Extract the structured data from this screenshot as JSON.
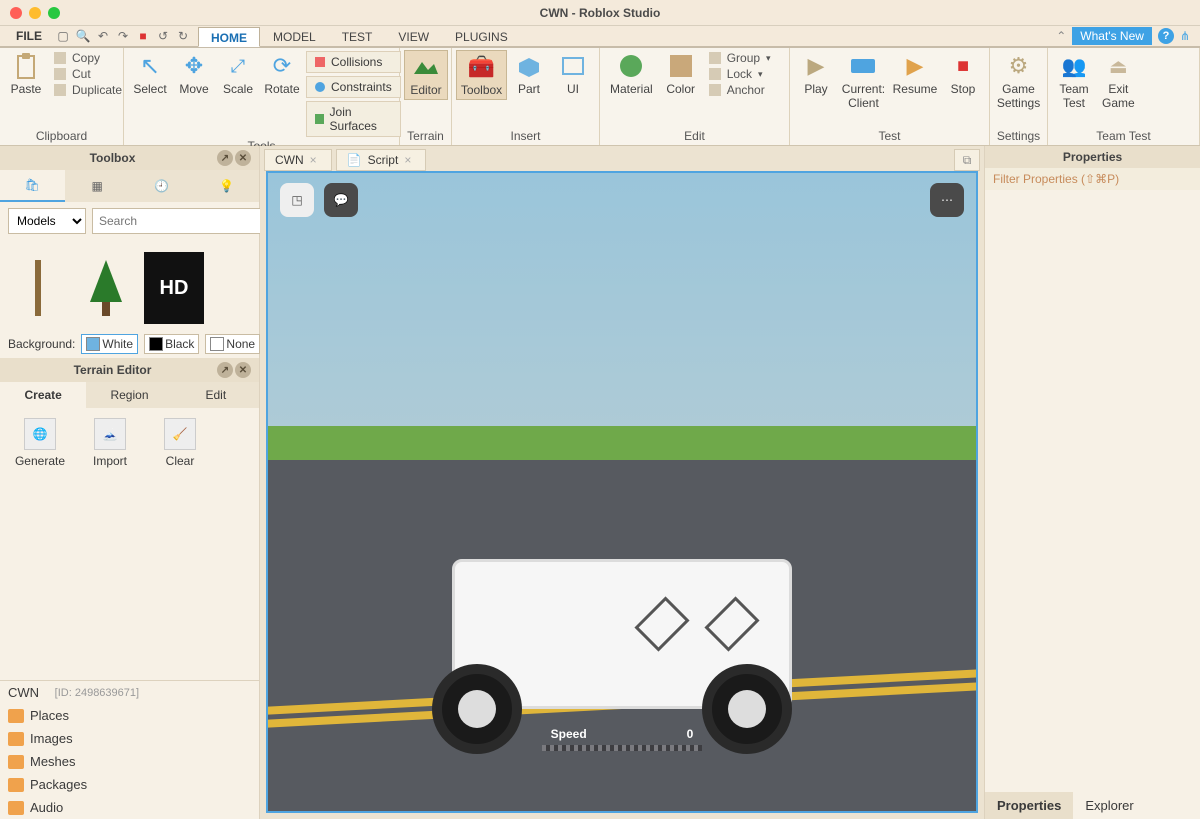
{
  "window": {
    "title": "CWN - Roblox Studio"
  },
  "menubar": {
    "file": "FILE",
    "tabs": [
      "HOME",
      "MODEL",
      "TEST",
      "VIEW",
      "PLUGINS"
    ],
    "active_tab": 0,
    "whatsnew": "What's New"
  },
  "ribbon": {
    "clipboard": {
      "paste": "Paste",
      "copy": "Copy",
      "cut": "Cut",
      "duplicate": "Duplicate",
      "label": "Clipboard"
    },
    "tools": {
      "select": "Select",
      "move": "Move",
      "scale": "Scale",
      "rotate": "Rotate",
      "collisions": "Collisions",
      "constraints": "Constraints",
      "join": "Join Surfaces",
      "label": "Tools"
    },
    "terrain": {
      "editor": "Editor",
      "label": "Terrain"
    },
    "insert": {
      "toolbox": "Toolbox",
      "part": "Part",
      "ui": "UI",
      "label": "Insert"
    },
    "edit": {
      "material": "Material",
      "color": "Color",
      "group": "Group",
      "lock": "Lock",
      "anchor": "Anchor",
      "label": "Edit"
    },
    "test": {
      "play": "Play",
      "current": "Current:",
      "client": "Client",
      "resume": "Resume",
      "stop": "Stop",
      "label": "Test"
    },
    "settings": {
      "game": "Game",
      "settings": "Settings",
      "label": "Settings"
    },
    "teamtest": {
      "team": "Team",
      "test": "Test",
      "exit": "Exit",
      "game": "Game",
      "label": "Team Test"
    }
  },
  "toolbox": {
    "title": "Toolbox",
    "dropdown": "Models",
    "search_ph": "Search",
    "bg_label": "Background:",
    "bg_opts": [
      "White",
      "Black",
      "None"
    ],
    "items_hd": "HD"
  },
  "terrain_editor": {
    "title": "Terrain Editor",
    "tabs": [
      "Create",
      "Region",
      "Edit"
    ],
    "buttons": [
      "Generate",
      "Import",
      "Clear"
    ]
  },
  "explorer": {
    "game": "CWN",
    "game_id": "[ID: 2498639671]",
    "items": [
      "Places",
      "Images",
      "Meshes",
      "Packages",
      "Audio"
    ]
  },
  "doc_tabs": {
    "tabs": [
      "CWN",
      "Script"
    ]
  },
  "viewport": {
    "speed_label": "Speed",
    "speed_value": "0"
  },
  "properties": {
    "title": "Properties",
    "filter": "Filter Properties (⇧⌘P)",
    "bottom_tabs": [
      "Properties",
      "Explorer"
    ]
  }
}
